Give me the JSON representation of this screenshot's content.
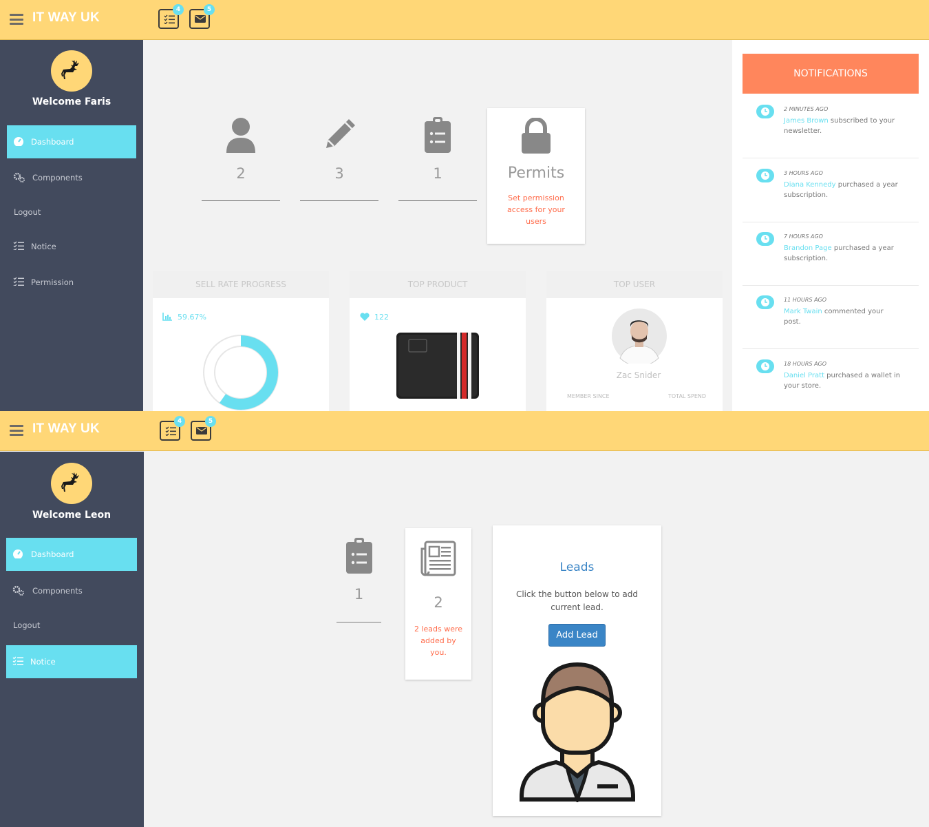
{
  "colors": {
    "header": "#ffd777",
    "sidebar": "#424a5d",
    "accent": "#68dff0",
    "notif_head": "#ff865c",
    "button": "#3a85c6"
  },
  "screen1": {
    "logo": "IT WAY UK",
    "badges": {
      "tasks": "4",
      "mail": "5"
    },
    "welcome": "Welcome Faris",
    "nav": [
      "Dashboard",
      "Components",
      "Logout",
      "Notice",
      "Permission"
    ],
    "stats": {
      "users": "2",
      "posts": "3",
      "tasks": "1"
    },
    "permits": {
      "title": "Permits",
      "desc": "Set permission access for your users"
    },
    "sell": {
      "title": "SELL RATE PROGRESS",
      "value": "59.67%",
      "progress": 0.5967
    },
    "product": {
      "title": "TOP PRODUCT",
      "likes": "122"
    },
    "topuser": {
      "title": "TOP USER",
      "name": "Zac Snider",
      "member_since": "MEMBER SINCE",
      "total_spend": "TOTAL SPEND"
    },
    "notifications": {
      "title": "NOTIFICATIONS",
      "items": [
        {
          "time": "2 MINUTES AGO",
          "name": "James Brown",
          "text": " subscribed to your newsletter."
        },
        {
          "time": "3 HOURS AGO",
          "name": "Diana Kennedy",
          "text": " purchased a year subscription."
        },
        {
          "time": "7 HOURS AGO",
          "name": "Brandon Page",
          "text": " purchased a year subscription."
        },
        {
          "time": "11 HOURS AGO",
          "name": "Mark Twain",
          "text": " commented your post."
        },
        {
          "time": "18 HOURS AGO",
          "name": "Daniel Pratt",
          "text": " purchased a wallet in your store."
        }
      ]
    }
  },
  "screen2": {
    "logo": "IT WAY UK",
    "badges": {
      "tasks": "4",
      "mail": "5"
    },
    "welcome": "Welcome Leon",
    "nav": [
      "Dashboard",
      "Components",
      "Logout",
      "Notice"
    ],
    "stats": {
      "tasks": "1",
      "leads": "2",
      "leads_desc": "2 leads were added by you."
    },
    "leads": {
      "title": "Leads",
      "desc": "Click the button below to add current lead.",
      "button": "Add Lead"
    }
  }
}
